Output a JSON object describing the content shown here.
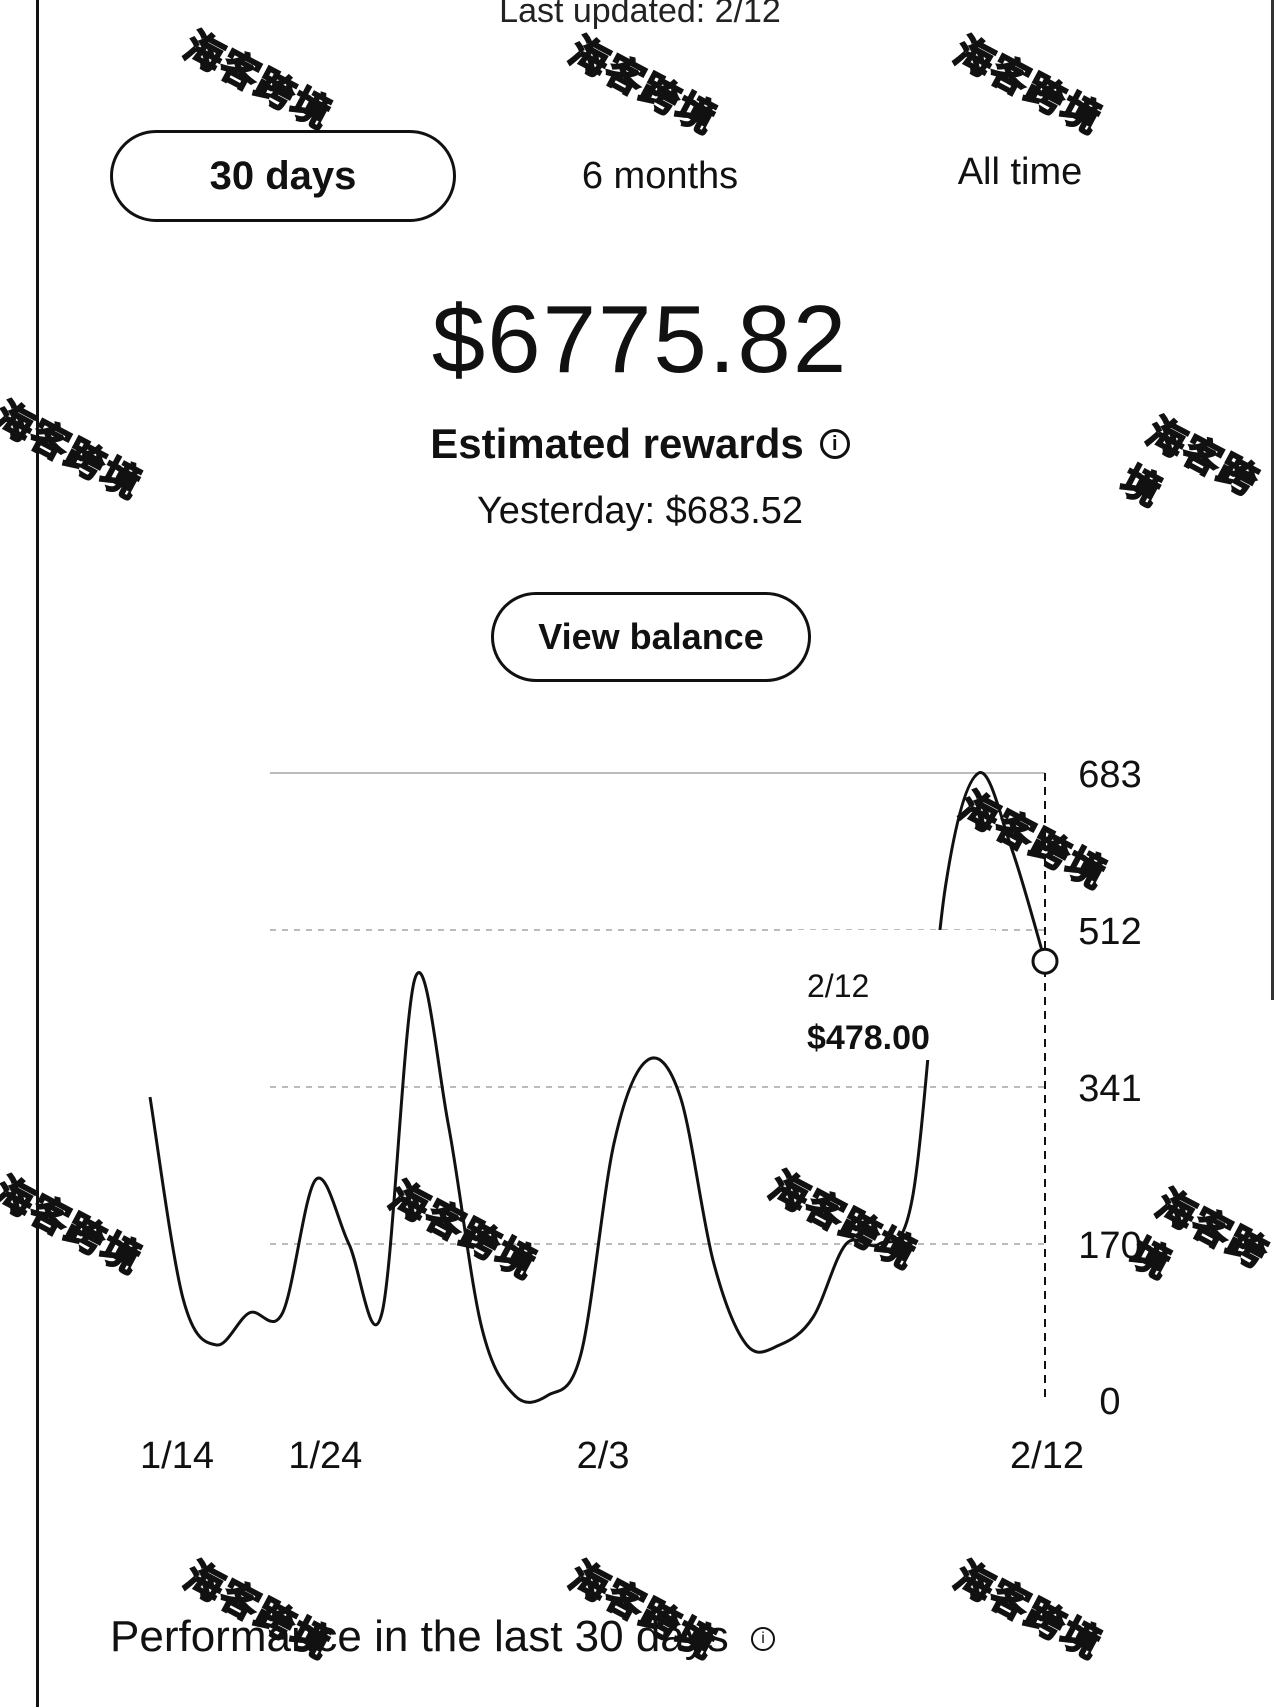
{
  "header": {
    "last_updated": "Last updated: 2/12"
  },
  "tabs": [
    {
      "label": "30 days",
      "active": true
    },
    {
      "label": "6 months",
      "active": false
    },
    {
      "label": "All time",
      "active": false
    }
  ],
  "summary": {
    "amount": "$6775.82",
    "label": "Estimated rewards",
    "info_icon": "info-icon",
    "yesterday": "Yesterday: $683.52",
    "view_balance_label": "View balance"
  },
  "tooltip": {
    "date": "2/12",
    "value": "$478.00"
  },
  "chart_data": {
    "type": "line",
    "x_ticks": [
      "1/14",
      "1/24",
      "2/3",
      "2/12"
    ],
    "y_ticks": [
      0,
      170,
      341,
      512,
      683
    ],
    "ylim": [
      0,
      683
    ],
    "grid": true,
    "series": [
      {
        "values": [
          [
            1,
            330
          ],
          [
            2,
            110
          ],
          [
            3,
            60
          ],
          [
            4,
            95
          ],
          [
            5,
            95
          ],
          [
            6,
            240
          ],
          [
            7,
            170
          ],
          [
            8,
            95
          ],
          [
            9,
            460
          ],
          [
            10,
            300
          ],
          [
            11,
            80
          ],
          [
            12,
            5
          ],
          [
            13,
            5
          ],
          [
            14,
            50
          ],
          [
            15,
            280
          ],
          [
            16,
            370
          ],
          [
            17,
            330
          ],
          [
            18,
            150
          ],
          [
            19,
            60
          ],
          [
            20,
            60
          ],
          [
            21,
            90
          ],
          [
            22,
            170
          ],
          [
            23,
            170
          ],
          [
            24,
            220
          ],
          [
            25,
            560
          ],
          [
            26,
            683
          ],
          [
            27,
            600
          ],
          [
            28,
            478
          ]
        ]
      }
    ],
    "highlight": {
      "x": 28,
      "y": 478
    }
  },
  "performance": {
    "title": "Performance in the last 30 days"
  },
  "watermark": {
    "text": "海客跨境"
  }
}
